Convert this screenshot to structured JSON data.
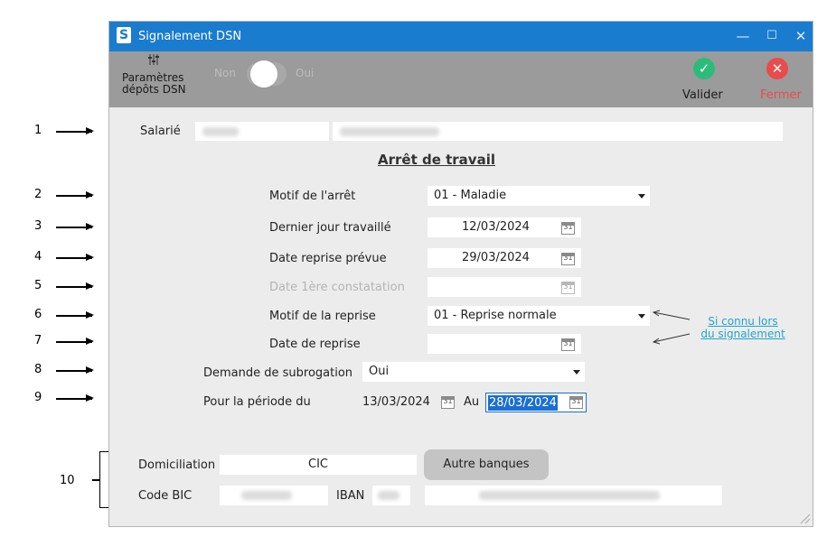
{
  "window": {
    "title": "Signalement DSN",
    "app_icon_letter": "S"
  },
  "window_controls": {
    "minimize": "—",
    "maximize": "☐",
    "close": "✕"
  },
  "toolbar": {
    "params_label_line1": "Paramètres",
    "params_label_line2": "dépôts DSN",
    "toggle_off_label": "Non",
    "toggle_on_label": "Oui",
    "validate_label": "Valider",
    "close_label": "Fermer"
  },
  "employee": {
    "label": "Salarié"
  },
  "section_title": "Arrêt de travail",
  "form": {
    "motif_arret": {
      "label": "Motif de l'arrêt",
      "value": "01 - Maladie"
    },
    "dernier_jour": {
      "label": "Dernier jour travaillé",
      "value": "12/03/2024"
    },
    "date_reprise_prevue": {
      "label": "Date reprise prévue",
      "value": "29/03/2024"
    },
    "date_constatation": {
      "label": "Date 1ère constatation",
      "value": ""
    },
    "motif_reprise": {
      "label": "Motif de la reprise",
      "value": "01 - Reprise normale"
    },
    "date_reprise": {
      "label": "Date de reprise",
      "value": ""
    },
    "subrogation": {
      "label": "Demande de subrogation",
      "value": "Oui"
    },
    "periode": {
      "label": "Pour la période du",
      "from": "13/03/2024",
      "au_label": "Au",
      "to": "28/03/2024"
    }
  },
  "bank": {
    "domiciliation_label": "Domiciliation",
    "domiciliation_value": "CIC",
    "autre_banques_label": "Autre banques",
    "bic_label": "Code BIC",
    "iban_label": "IBAN"
  },
  "note": {
    "line1": "Si connu lors",
    "line2": "du signalement"
  },
  "annotations": [
    "1",
    "2",
    "3",
    "4",
    "5",
    "6",
    "7",
    "8",
    "9",
    "10"
  ],
  "calendar_icon_text": "31",
  "colors": {
    "titlebar": "#1a7ccf",
    "validate": "#2dbb7c",
    "close": "#e84c4c",
    "link": "#23a5c8",
    "selection": "#1a6fd0"
  }
}
